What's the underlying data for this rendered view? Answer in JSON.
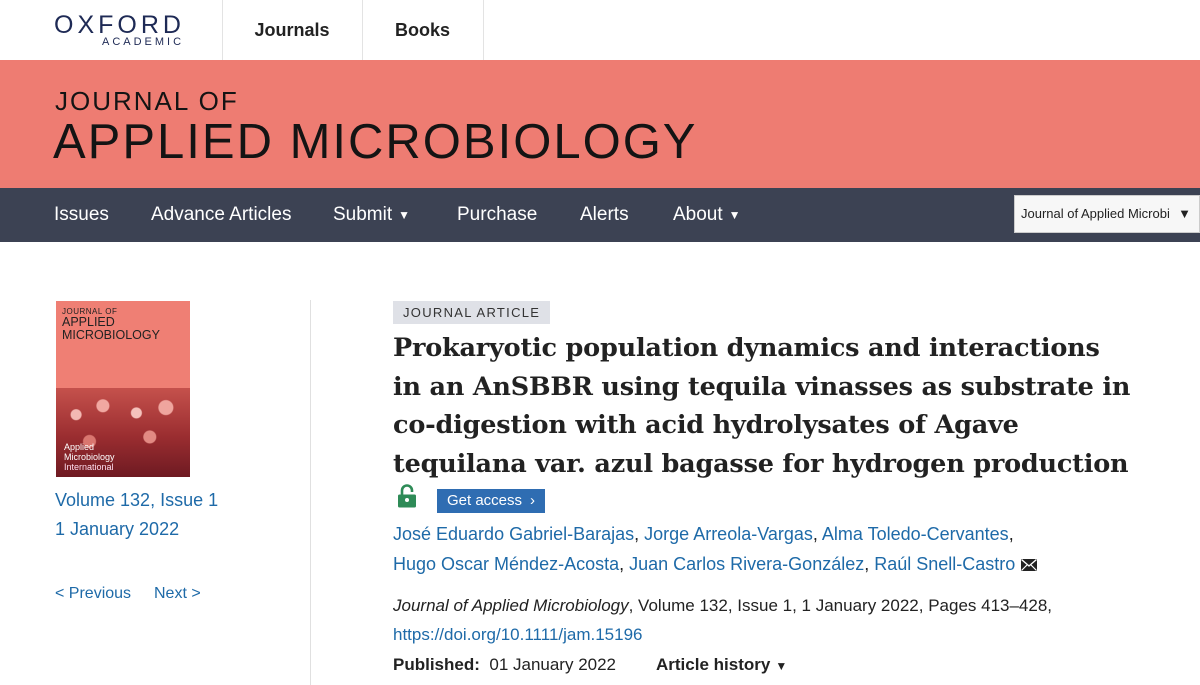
{
  "topbar": {
    "logo_main": "OXFORD",
    "logo_sub": "ACADEMIC",
    "links": [
      "Journals",
      "Books"
    ]
  },
  "banner": {
    "pre": "JOURNAL OF",
    "main": "APPLIED MICROBIOLOGY"
  },
  "nav": {
    "items": [
      {
        "label": "Issues",
        "caret": false
      },
      {
        "label": "Advance Articles",
        "caret": false
      },
      {
        "label": "Submit",
        "caret": true
      },
      {
        "label": "Purchase",
        "caret": false
      },
      {
        "label": "Alerts",
        "caret": false
      },
      {
        "label": "About",
        "caret": true
      }
    ],
    "journal_select": "Journal of Applied Microbi"
  },
  "cover": {
    "top": "JOURNAL OF",
    "title_line1": "APPLIED",
    "title_line2": "MICROBIOLOGY",
    "sub1": "Applied",
    "sub2": "Microbiology",
    "sub3": "International"
  },
  "issue": {
    "volume": "Volume 132, Issue 1",
    "date": "1 January 2022",
    "previous": "< Previous",
    "next": "Next >"
  },
  "article": {
    "type": "JOURNAL ARTICLE",
    "title_lines": [
      "Prokaryotic population dynamics and interactions",
      "in an AnSBBR using tequila vinasses as substrate in",
      "co-digestion with acid hydrolysates of Agave",
      "tequilana var. azul bagasse for hydrogen production"
    ],
    "access_label": "Get access",
    "authors_line1": [
      "José Eduardo Gabriel-Barajas",
      "Jorge Arreola-Vargas",
      "Alma Toledo-Cervantes"
    ],
    "authors_line2": [
      "Hugo Oscar Méndez-Acosta",
      "Juan Carlos Rivera-González",
      "Raúl Snell-Castro"
    ],
    "citation_journal": "Journal of Applied Microbiology",
    "citation_rest": ", Volume 132, Issue 1, 1 January 2022, Pages 413–428,",
    "doi": "https://doi.org/10.1111/jam.15196",
    "published_label": "Published:",
    "published_date": "01 January 2022",
    "history_label": "Article history"
  },
  "colors": {
    "banner": "#ee7c72",
    "nav": "#3c4253",
    "link": "#1e6aa8",
    "button": "#2f6db2",
    "lock": "#2e8b57"
  }
}
